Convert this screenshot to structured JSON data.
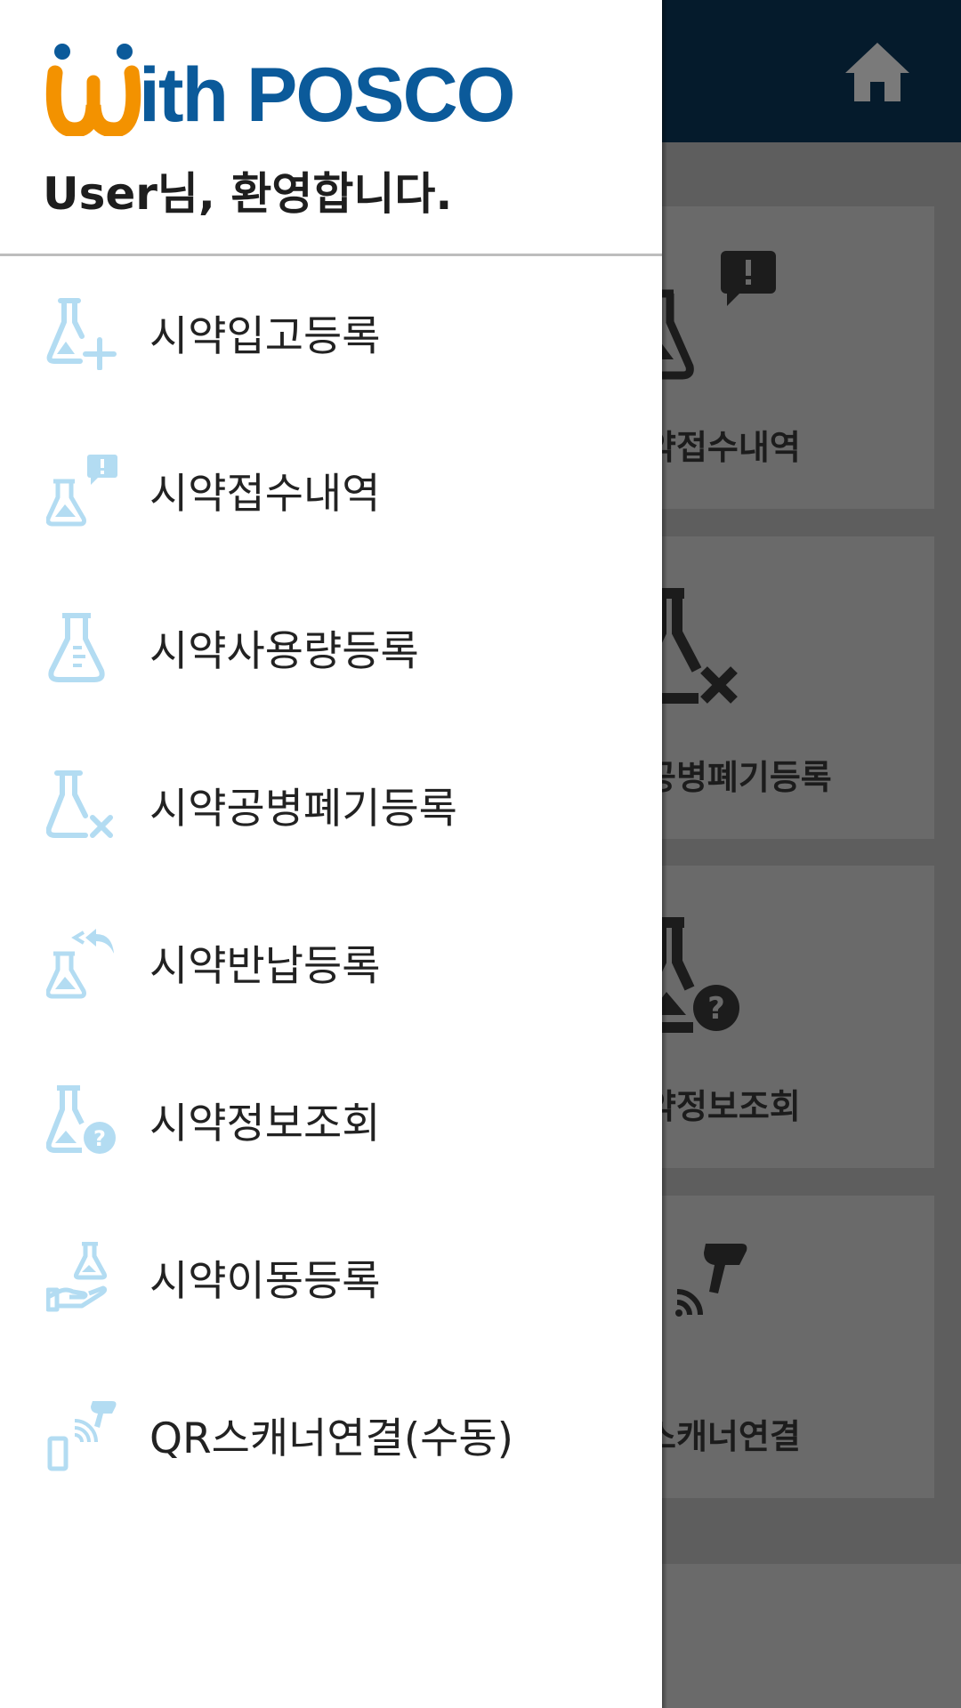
{
  "app": {
    "logo_text": "ith POSCO",
    "logo_full": "With POSCO",
    "welcome": "User님, 환영합니다."
  },
  "colors": {
    "brand_blue": "#0b5a9a",
    "brand_orange": "#f39200",
    "icon_light_blue": "#b3dcf2",
    "header_navy": "#051b2c"
  },
  "drawer": {
    "items": [
      {
        "label": "시약입고등록",
        "icon": "flask-plus-icon"
      },
      {
        "label": "시약접수내역",
        "icon": "flask-alert-icon"
      },
      {
        "label": "시약사용량등록",
        "icon": "flask-measure-icon"
      },
      {
        "label": "시약공병폐기등록",
        "icon": "flask-x-icon"
      },
      {
        "label": "시약반납등록",
        "icon": "flask-return-icon"
      },
      {
        "label": "시약정보조회",
        "icon": "flask-question-icon"
      },
      {
        "label": "시약이동등록",
        "icon": "hand-flask-icon"
      },
      {
        "label": "QR스캐너연결(수동)",
        "icon": "phone-scanner-icon"
      }
    ]
  },
  "background": {
    "cards": [
      {
        "label": "약접수내역",
        "icon": "flask-alert-icon"
      },
      {
        "label": "공병폐기등록",
        "icon": "flask-x-icon"
      },
      {
        "label": "약정보조회",
        "icon": "flask-question-icon"
      },
      {
        "label": "스캐너연결",
        "icon": "phone-scanner-icon"
      }
    ]
  }
}
